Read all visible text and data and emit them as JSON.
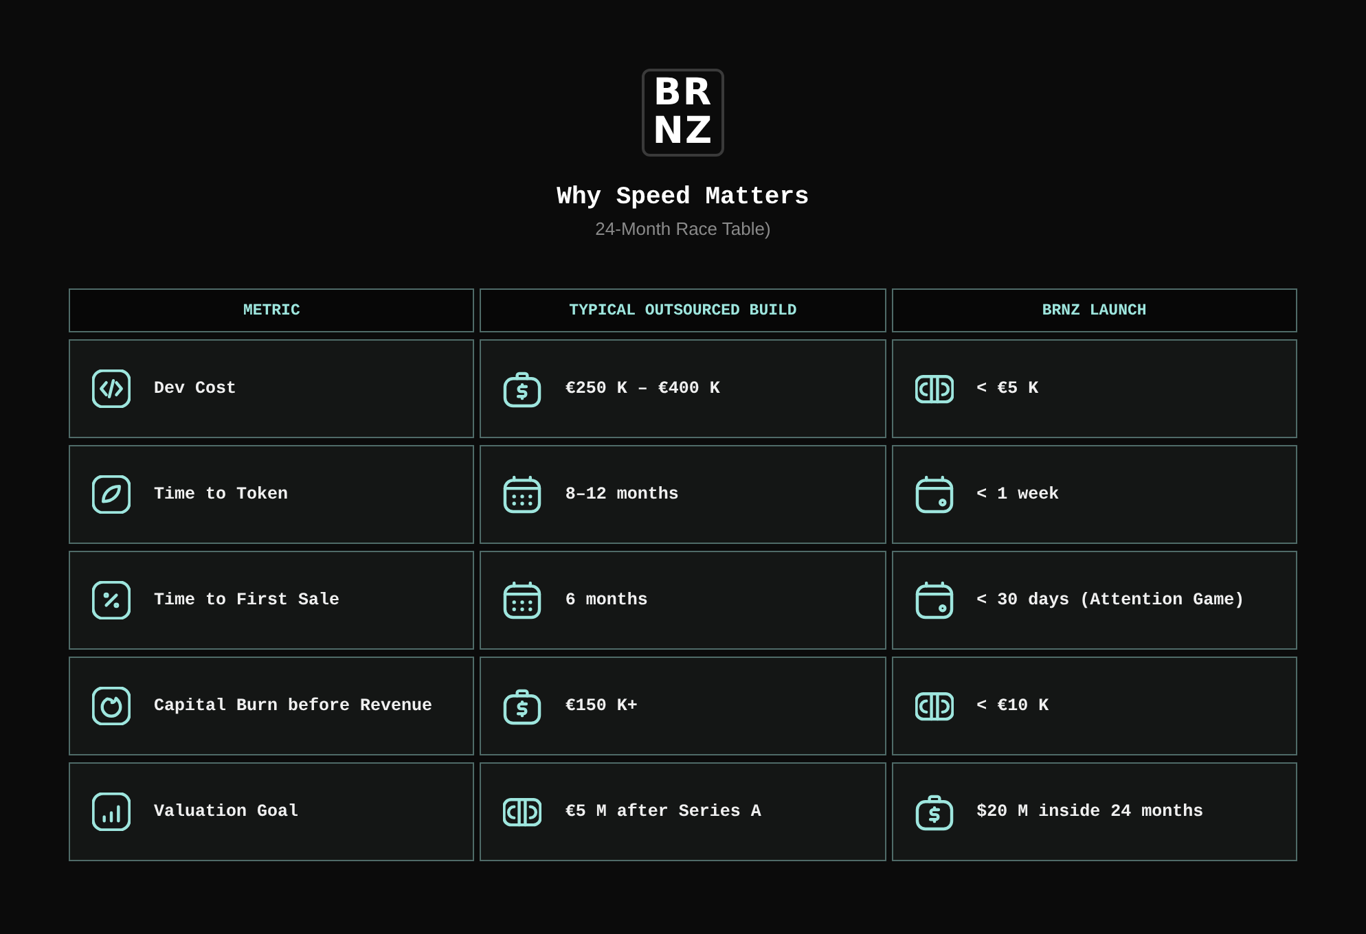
{
  "logo": {
    "lines": [
      "BR",
      "NZ"
    ]
  },
  "title": "Why Speed Matters",
  "subtitle": "24-Month Race Table)",
  "table": {
    "columns": [
      "METRIC",
      "TYPICAL OUTSOURCED BUILD",
      "BRNZ LAUNCH"
    ],
    "rows": [
      [
        {
          "kind": "code",
          "text": "Dev Cost"
        },
        {
          "kind": "bag",
          "text": "€250 K – €400 K"
        },
        {
          "kind": "ticket",
          "text": "< €5 K"
        }
      ],
      [
        {
          "kind": "leaf",
          "text": "Time to Token"
        },
        {
          "kind": "calendar",
          "text": "8–12 months"
        },
        {
          "kind": "wallet",
          "text": "< 1 week"
        }
      ],
      [
        {
          "kind": "percent",
          "text": "Time to First Sale"
        },
        {
          "kind": "calendar",
          "text": "6 months"
        },
        {
          "kind": "wallet",
          "text": "< 30 days (Attention Game)"
        }
      ],
      [
        {
          "kind": "flame",
          "text": "Capital Burn before Revenue"
        },
        {
          "kind": "bag",
          "text": "€150 K+"
        },
        {
          "kind": "ticket",
          "text": "< €10 K"
        }
      ],
      [
        {
          "kind": "chart",
          "text": "Valuation Goal"
        },
        {
          "kind": "ticket",
          "text": "€5 M after Series A"
        },
        {
          "kind": "bag",
          "text": "$20 M inside 24 months"
        }
      ]
    ]
  }
}
